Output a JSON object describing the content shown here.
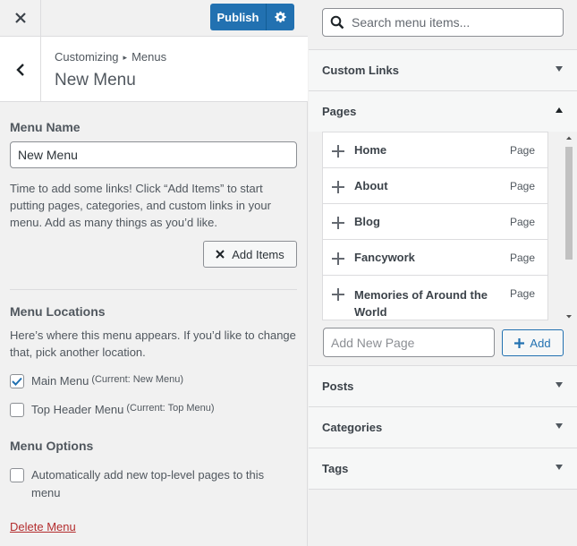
{
  "topbar": {
    "publish_label": "Publish"
  },
  "header": {
    "breadcrumb_root": "Customizing",
    "breadcrumb_sep": "▸",
    "breadcrumb_current": "Menus",
    "title": "New Menu"
  },
  "menu_name": {
    "label": "Menu Name",
    "value": "New Menu",
    "help_line1": "Time to add some links! Click “Add Items” to start",
    "help_line2": "putting pages, categories, and custom links in your",
    "help_line3": "menu. Add as many things as you’d like.",
    "add_items_label": "Add Items"
  },
  "locations": {
    "label": "Menu Locations",
    "help_line1": "Here’s where this menu appears. If you’d like to change",
    "help_line2": "that, pick another location.",
    "items": [
      {
        "label": "Main Menu",
        "note": "(Current: New Menu)",
        "checked": true
      },
      {
        "label": "Top Header Menu",
        "note": "(Current: Top Menu)",
        "checked": false
      }
    ]
  },
  "options": {
    "label": "Menu Options",
    "auto_add_line1": "Automatically add new top-level pages to this",
    "auto_add_line2": "menu",
    "auto_add_checked": false
  },
  "delete_label": "Delete Menu",
  "right": {
    "search_placeholder": "Search menu items...",
    "sections": {
      "custom_links": "Custom Links",
      "pages": "Pages",
      "posts": "Posts",
      "categories": "Categories",
      "tags": "Tags"
    },
    "pages": [
      {
        "title": "Home",
        "type": "Page"
      },
      {
        "title": "About",
        "type": "Page"
      },
      {
        "title": "Blog",
        "type": "Page"
      },
      {
        "title": "Fancywork",
        "type": "Page"
      },
      {
        "title": "Memories of Around the World",
        "type": "Page"
      }
    ],
    "add_new_page_placeholder": "Add New Page",
    "add_label": "Add"
  },
  "colors": {
    "primary": "#2271b1",
    "danger": "#b32d2e"
  }
}
